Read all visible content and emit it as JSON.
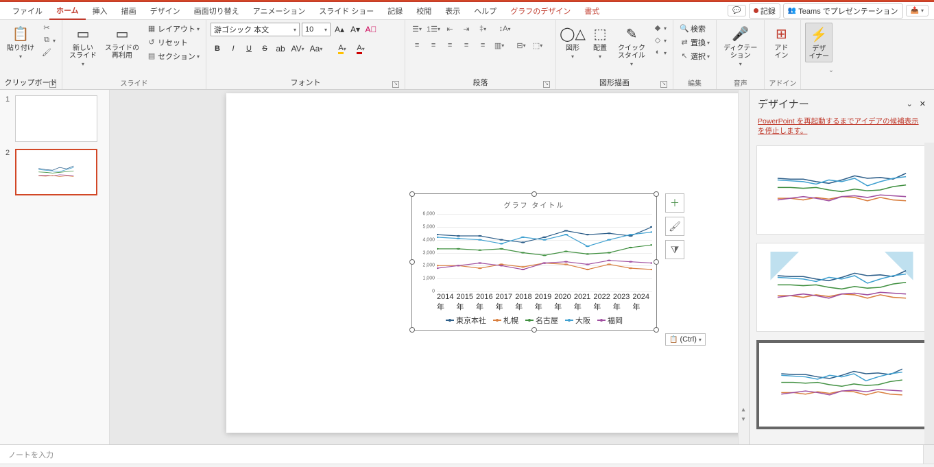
{
  "tabs": {
    "file": "ファイル",
    "home": "ホーム",
    "insert": "挿入",
    "draw": "描画",
    "design": "デザイン",
    "transition": "画面切り替え",
    "animation": "アニメーション",
    "slideshow": "スライド ショー",
    "record": "記録",
    "review": "校閲",
    "view": "表示",
    "help": "ヘルプ",
    "chartdesign": "グラフのデザイン",
    "format": "書式"
  },
  "topright": {
    "recordBtn": "記録",
    "teams": "Teams でプレゼンテーション"
  },
  "ribbon": {
    "clipboard": {
      "label": "クリップボード",
      "paste": "貼り付け"
    },
    "slides": {
      "label": "スライド",
      "new": "新しい\nスライド",
      "reuse": "スライドの\n再利用",
      "layout": "レイアウト",
      "reset": "リセット",
      "section": "セクション"
    },
    "font": {
      "label": "フォント",
      "name": "游ゴシック 本文",
      "size": "10"
    },
    "paragraph": {
      "label": "段落"
    },
    "drawing": {
      "label": "図形描画",
      "shapes": "図形",
      "arrange": "配置",
      "quick": "クイック\nスタイル"
    },
    "editing": {
      "label": "編集",
      "find": "検索",
      "replace": "置換",
      "select": "選択"
    },
    "voice": {
      "label": "音声",
      "dictate": "ディクテー\nション"
    },
    "addins": {
      "label": "アドイン",
      "addin": "アド\nイン"
    },
    "designer": {
      "label": "",
      "btn": "デザ\nイナー"
    }
  },
  "thumbs": {
    "n1": "1",
    "n2": "2"
  },
  "chart_data": {
    "type": "line",
    "title": "グラフ タイトル",
    "categories": [
      "2014年",
      "2015年",
      "2016年",
      "2017年",
      "2018年",
      "2019年",
      "2020年",
      "2021年",
      "2022年",
      "2023年",
      "2024年"
    ],
    "ylim": [
      0,
      6000
    ],
    "yticks": [
      "0",
      "1,000",
      "2,000",
      "3,000",
      "4,000",
      "5,000",
      "6,000"
    ],
    "series": [
      {
        "name": "東京本社",
        "color": "#2e5f8a",
        "values": [
          4400,
          4300,
          4300,
          4000,
          3800,
          4200,
          4700,
          4400,
          4500,
          4300,
          5000
        ]
      },
      {
        "name": "札幌",
        "color": "#d97f3f",
        "values": [
          2000,
          2000,
          1800,
          2100,
          1900,
          2200,
          2100,
          1700,
          2100,
          1800,
          1700
        ]
      },
      {
        "name": "名古屋",
        "color": "#3f8f3f",
        "values": [
          3300,
          3300,
          3200,
          3300,
          3000,
          2800,
          3100,
          2900,
          3000,
          3400,
          3600
        ]
      },
      {
        "name": "大阪",
        "color": "#3fa0d0",
        "values": [
          4200,
          4100,
          4000,
          3700,
          4200,
          4000,
          4400,
          3500,
          4000,
          4400,
          4600
        ]
      },
      {
        "name": "福岡",
        "color": "#a04fa0",
        "values": [
          1800,
          2000,
          2200,
          2000,
          1700,
          2200,
          2300,
          2100,
          2400,
          2300,
          2200
        ]
      }
    ]
  },
  "pasteOpt": "(Ctrl)",
  "notes": "ノートを入力",
  "designerPane": {
    "title": "デザイナー",
    "link": "PowerPoint を再起動するまでアイデアの候補表示を停止します。"
  }
}
